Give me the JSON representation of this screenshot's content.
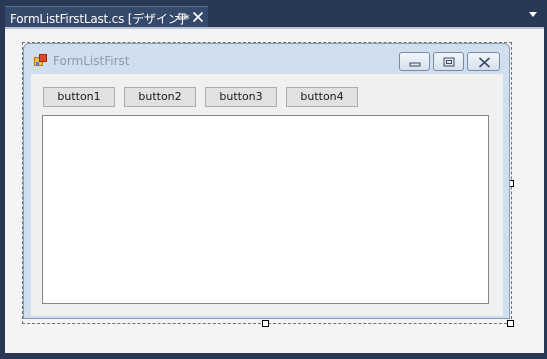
{
  "document_tab": {
    "title": "FormListFirstLast.cs [デザイン]*",
    "icons": [
      "pin-icon",
      "close-icon",
      "dropdown-icon"
    ]
  },
  "form": {
    "title": "FormListFirst",
    "caption_buttons": [
      "minimize-icon",
      "maximize-icon",
      "close-icon"
    ],
    "buttons": [
      {
        "label": "button1"
      },
      {
        "label": "button2"
      },
      {
        "label": "button3"
      },
      {
        "label": "button4"
      }
    ],
    "listbox_items": []
  },
  "colors": {
    "ide_background": "#293955",
    "tab_background": "#35496a",
    "designer_background": "#f4f4f4",
    "form_frame": "#cfdff0",
    "form_client": "#f0f0f0",
    "listbox": "#ffffff"
  }
}
